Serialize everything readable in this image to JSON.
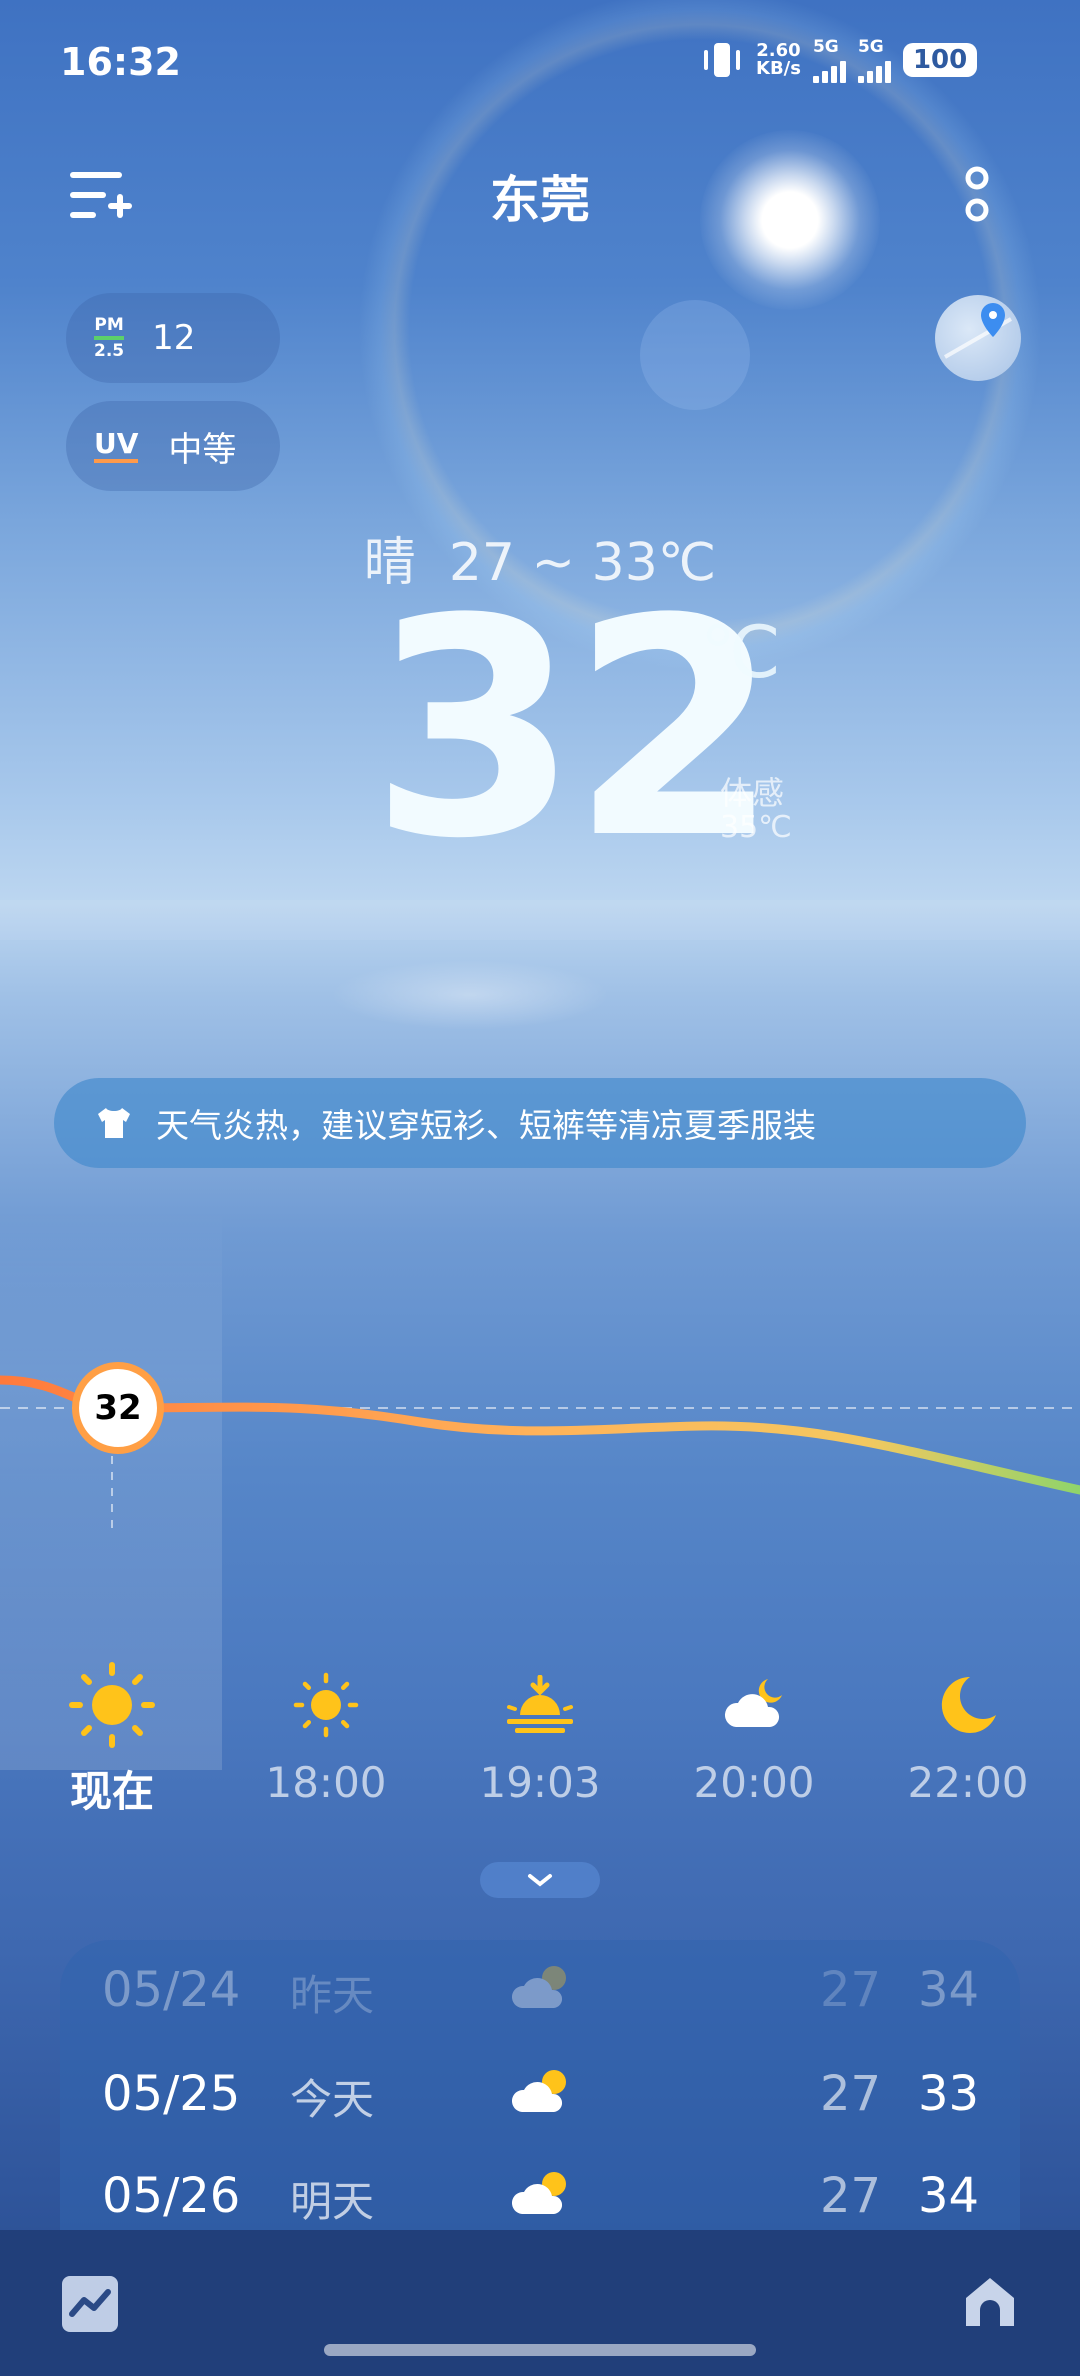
{
  "status_bar": {
    "time": "16:32",
    "speed_value": "2.60",
    "speed_unit": "KB/s",
    "network_1": "5G",
    "network_2": "5G",
    "battery": "100",
    "icons": [
      "vibrate-icon",
      "signal-icon",
      "battery-icon"
    ]
  },
  "header": {
    "city": "东莞",
    "menu_icon": "add-city-menu-icon",
    "more_icon": "more-icon",
    "map_icon": "map-location-icon"
  },
  "air": {
    "pm_top": "PM",
    "pm_bottom": "2.5",
    "pm_value": "12",
    "uv_label": "UV",
    "uv_value": "中等"
  },
  "current": {
    "condition": "晴",
    "range": "27 ~ 33℃",
    "temperature": "32",
    "unit": "℃",
    "feels_label": "体感",
    "feels_value": "35℃"
  },
  "advice": {
    "icon": "shirt-icon",
    "text": "天气炎热，建议穿短衫、短裤等清凉夏季服装"
  },
  "hourly": {
    "now_temp": "32",
    "items": [
      {
        "label": "现在",
        "icon": "sun-icon"
      },
      {
        "label": "18:00",
        "icon": "sun-icon"
      },
      {
        "label": "19:03",
        "icon": "sunset-icon"
      },
      {
        "label": "20:00",
        "icon": "cloud-moon-icon"
      },
      {
        "label": "22:00",
        "icon": "moon-icon"
      }
    ],
    "expand_icon": "chevron-down-icon"
  },
  "daily": [
    {
      "date": "05/24",
      "day": "昨天",
      "icon": "partly-cloudy-icon",
      "low": "27",
      "high": "34"
    },
    {
      "date": "05/25",
      "day": "今天",
      "icon": "partly-cloudy-icon",
      "low": "27",
      "high": "33"
    },
    {
      "date": "05/26",
      "day": "明天",
      "icon": "partly-cloudy-icon",
      "low": "27",
      "high": "34"
    }
  ],
  "bottom_nav": {
    "trend_icon": "trend-chart-icon",
    "home_icon": "home-icon"
  },
  "colors": {
    "curve_start": "#ff7a3c",
    "curve_mid": "#ffb35a",
    "curve_end": "#8fd46a",
    "sun_yellow": "#ffc31a"
  }
}
